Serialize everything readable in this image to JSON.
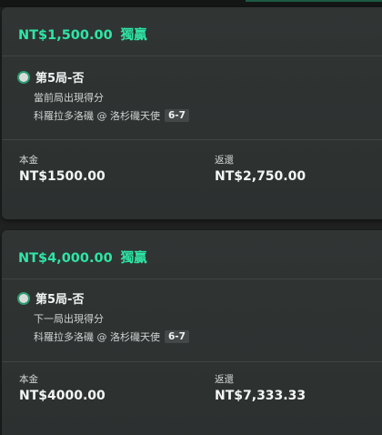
{
  "bets": [
    {
      "amount": "NT$1,500.00",
      "status": "獨贏",
      "selection": "第5局-否",
      "market": "當前局出現得分",
      "event": "科羅拉多洛磯 @ 洛杉磯天使",
      "score": "6-7",
      "stake_label": "本金",
      "stake_value": "NT$1500.00",
      "return_label": "返還",
      "return_value": "NT$2,750.00"
    },
    {
      "amount": "NT$4,000.00",
      "status": "獨贏",
      "selection": "第5局-否",
      "market": "下一局出現得分",
      "event": "科羅拉多洛磯 @ 洛杉磯天使",
      "score": "6-7",
      "stake_label": "本金",
      "stake_value": "NT$4000.00",
      "return_label": "返還",
      "return_value": "NT$7,333.33"
    }
  ],
  "colors": {
    "accent": "#2ee6a6",
    "card_bg": "#303534",
    "page_bg": "#1e2120"
  },
  "icons": {
    "selection": "radio-selected-icon"
  }
}
